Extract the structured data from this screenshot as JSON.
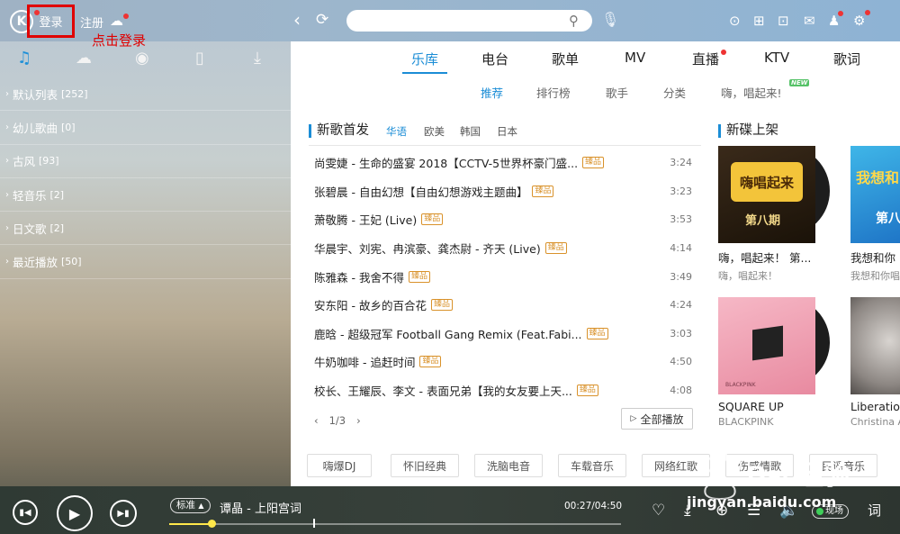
{
  "header": {
    "logo": "K",
    "login": "登录",
    "register": "注册",
    "annotation": "点击登录",
    "search_placeholder": "",
    "icons": [
      "chevron-left-icon",
      "refresh-icon",
      "search-icon",
      "mic-icon",
      "play-circle-icon",
      "apps-icon",
      "gamepad-icon",
      "mail-icon",
      "shirt-icon",
      "gear-icon"
    ]
  },
  "left_tabs": [
    "music-note-icon",
    "cloud-icon",
    "radio-icon",
    "device-icon",
    "download-icon"
  ],
  "playlists": [
    {
      "name": "默认列表",
      "count": "[252]"
    },
    {
      "name": "幼儿歌曲",
      "count": "[0]"
    },
    {
      "name": "古风",
      "count": "[93]"
    },
    {
      "name": "轻音乐",
      "count": "[2]"
    },
    {
      "name": "日文歌",
      "count": "[2]"
    },
    {
      "name": "最近播放",
      "count": "[50]"
    }
  ],
  "main_tabs": [
    "乐库",
    "电台",
    "歌单",
    "MV",
    "直播",
    "KTV",
    "歌词"
  ],
  "sub_tabs": [
    "推荐",
    "排行榜",
    "歌手",
    "分类",
    "嗨，唱起来!"
  ],
  "new_badge": "NEW",
  "new_songs": {
    "title": "新歌首发",
    "lang_tabs": [
      "华语",
      "欧美",
      "韩国",
      "日本"
    ],
    "lossless_label": "臻品",
    "songs": [
      {
        "title": "尚雯婕 - 生命的盛宴 2018【CCTV-5世界杯豪门盛...",
        "time": "3:24"
      },
      {
        "title": "张碧晨 - 自由幻想【自由幻想游戏主题曲】",
        "time": "3:23"
      },
      {
        "title": "萧敬腾 - 王妃 (Live)",
        "time": "3:53"
      },
      {
        "title": "华晨宇、刘宪、冉滨豪、龚杰尉 - 齐天 (Live)",
        "time": "4:14"
      },
      {
        "title": "陈雅森 - 我舍不得",
        "time": "3:49"
      },
      {
        "title": "安东阳 - 故乡的百合花",
        "time": "4:24"
      },
      {
        "title": "鹿晗 - 超级冠军 Football Gang Remix (Feat.Fabi...",
        "time": "3:03"
      },
      {
        "title": "牛奶咖啡 - 追赶时间",
        "time": "4:50"
      },
      {
        "title": "校长、王耀辰、李文 - 表面兄弟【我的女友要上天...",
        "time": "4:08"
      }
    ],
    "pager": "1/3",
    "play_all": "全部播放"
  },
  "new_albums": {
    "title": "新碟上架",
    "albums": [
      {
        "title": "嗨，唱起来！ 第...",
        "sub": "嗨，唱起来！",
        "art_text": "嗨唱起来",
        "art_text2": "第八期"
      },
      {
        "title": "我想和你",
        "sub": "我想和你唱",
        "art_text": "我想和",
        "art_text2": "第八"
      },
      {
        "title": "SQUARE UP",
        "sub": "BLACKPINK",
        "art_text": "BLACKPINK"
      },
      {
        "title": "Liberatio",
        "sub": "Christina A",
        "art_text": ""
      }
    ]
  },
  "tags": [
    "嗨爆DJ",
    "怀旧经典",
    "洗脑电音",
    "车载音乐",
    "网络红歌",
    "伤感情歌",
    "民谣音乐"
  ],
  "player": {
    "quality": "标准",
    "now_playing": "谭晶 - 上阳宫词",
    "time": "00:27/04:50",
    "progress": 0.093,
    "live": "现场",
    "lyric": "词"
  },
  "watermark": {
    "text": "Bai 经验",
    "url": "jingyan.baidu.com"
  },
  "colors": {
    "accent": "#1b8dd6",
    "highlight_box": "#e00000",
    "progress": "#ffe84a"
  }
}
